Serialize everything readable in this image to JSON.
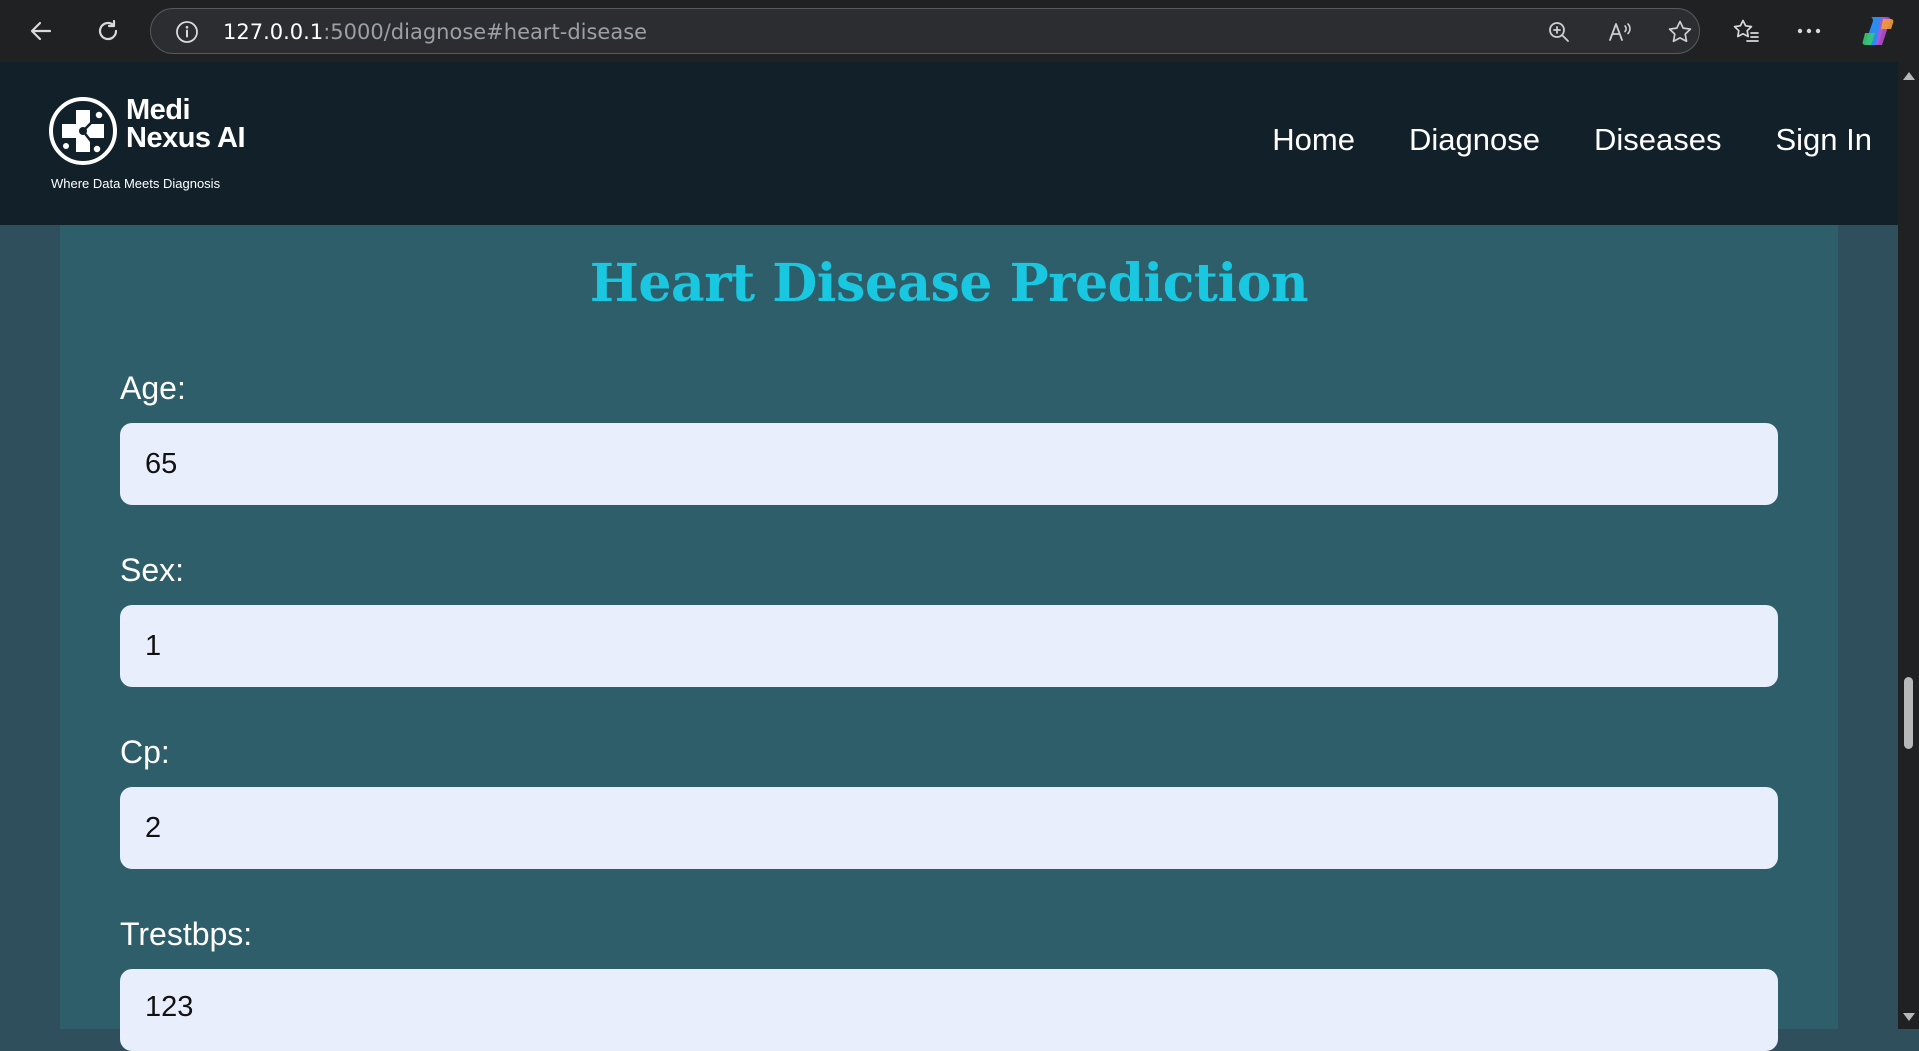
{
  "browser": {
    "url_host": "127.0.0.1",
    "url_rest": ":5000/diagnose#heart-disease"
  },
  "site": {
    "logo_line1": "Medi",
    "logo_line2": "Nexus AI",
    "tagline": "Where Data Meets Diagnosis",
    "nav": [
      "Home",
      "Diagnose",
      "Diseases",
      "Sign In"
    ]
  },
  "form": {
    "title": "Heart Disease Prediction",
    "fields": [
      {
        "label": "Age:",
        "value": "65"
      },
      {
        "label": "Sex:",
        "value": "1"
      },
      {
        "label": "Cp:",
        "value": "2"
      },
      {
        "label": "Trestbps:",
        "value": "123"
      }
    ]
  },
  "colors": {
    "header_bg": "#12202a",
    "panel_bg": "#2d5e6a",
    "title": "#19c7e0",
    "input_bg": "#e8eefb"
  }
}
